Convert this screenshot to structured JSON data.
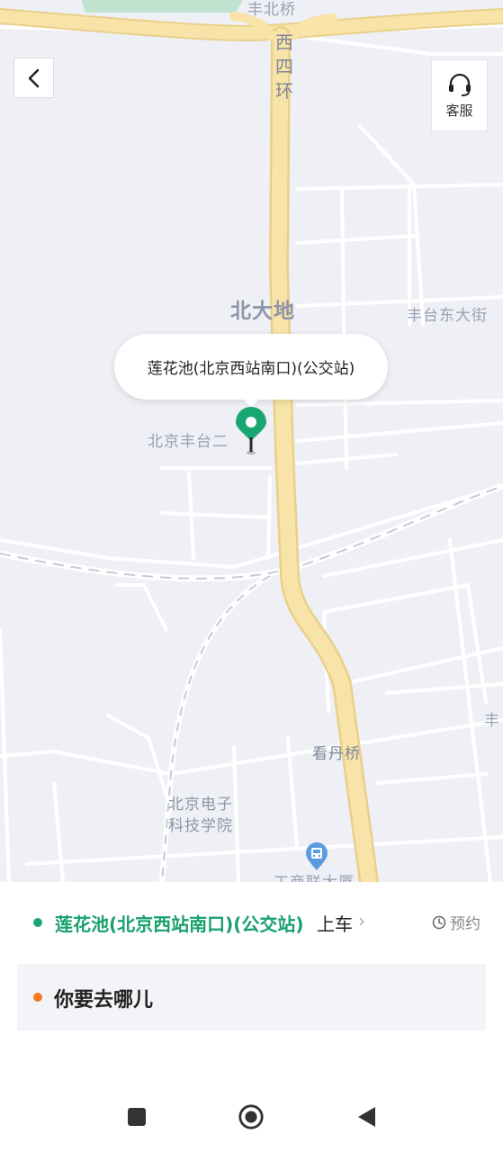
{
  "map": {
    "road_labels": {
      "fengbei_bridge": "丰北桥",
      "west_4th_ring": [
        "西",
        "四",
        "环"
      ],
      "beidadi": "北大地",
      "fengtai_east_street": "丰台东大街",
      "beijing_fengtai_er": "北京丰台二",
      "kandan_bridge": "看丹桥",
      "beijing_electronics_college": [
        "北京电子",
        "科技学院"
      ],
      "feng_right_edge": "丰",
      "bottom_partial": "工商联大厦"
    },
    "road_color": "#f6dfa0",
    "background_color": "#eef0f5"
  },
  "header": {
    "back_icon": "chevron-left-icon",
    "service_label": "客服",
    "service_icon": "headset-icon"
  },
  "pickup_bubble": {
    "label": "莲花池(北京西站南口)(公交站)"
  },
  "pickup": {
    "station_name": "莲花池(北京西站南口)(公交站)",
    "action_suffix": "上车",
    "chevron": "›",
    "accent_color": "#17a06c"
  },
  "reserve": {
    "label": "预约",
    "icon": "clock-icon"
  },
  "destination": {
    "placeholder": "你要去哪儿",
    "dot_color": "#f47a21"
  },
  "system_nav": {
    "recents_icon": "square-icon",
    "home_icon": "circle-icon",
    "back_icon": "triangle-back-icon"
  }
}
